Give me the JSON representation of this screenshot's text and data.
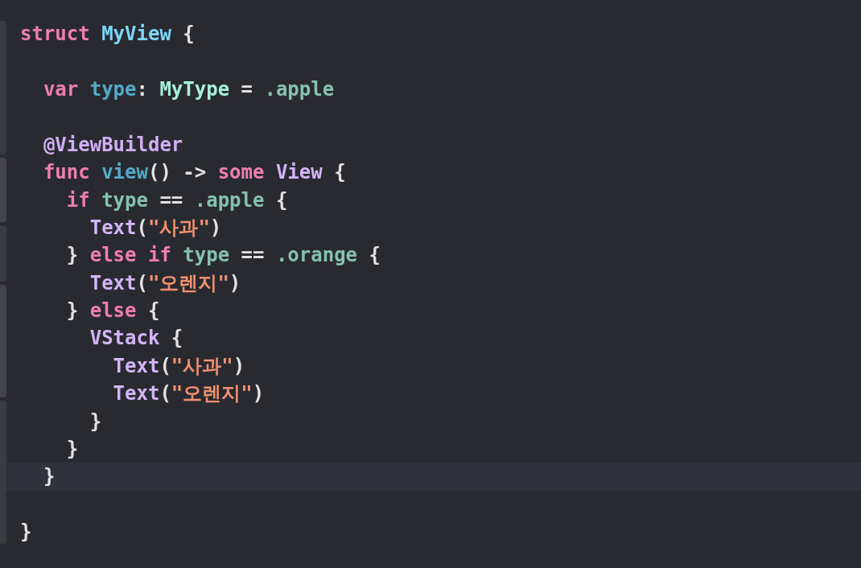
{
  "editor": {
    "lines": [
      {
        "kind": "line",
        "tokens": [
          {
            "text": "struct ",
            "kind": "keyword"
          },
          {
            "text": "MyView",
            "kind": "declaration"
          },
          {
            "text": " {",
            "kind": "plain"
          }
        ]
      },
      {
        "kind": "line"
      },
      {
        "kind": "line",
        "tokens": [
          {
            "text": "  var ",
            "kind": "keyword"
          },
          {
            "text": "type",
            "kind": "property"
          },
          {
            "text": ": ",
            "kind": "plain"
          },
          {
            "text": "MyType",
            "kind": "type"
          },
          {
            "text": " = ",
            "kind": "plain"
          },
          {
            "text": ".apple",
            "kind": "member"
          }
        ]
      },
      {
        "kind": "line"
      },
      {
        "kind": "line",
        "tokens": [
          {
            "text": "  @ViewBuilder",
            "kind": "attribute"
          }
        ]
      },
      {
        "kind": "line",
        "tokens": [
          {
            "text": "  func ",
            "kind": "keyword"
          },
          {
            "text": "view",
            "kind": "property"
          },
          {
            "text": "() -> ",
            "kind": "plain"
          },
          {
            "text": "some ",
            "kind": "keyword"
          },
          {
            "text": "View",
            "kind": "library"
          },
          {
            "text": " {",
            "kind": "plain"
          }
        ]
      },
      {
        "kind": "line",
        "tokens": [
          {
            "text": "    if ",
            "kind": "keyword"
          },
          {
            "text": "type",
            "kind": "member"
          },
          {
            "text": " == ",
            "kind": "plain"
          },
          {
            "text": ".apple",
            "kind": "member"
          },
          {
            "text": " {",
            "kind": "plain"
          }
        ]
      },
      {
        "kind": "line",
        "tokens": [
          {
            "text": "      Text",
            "kind": "library"
          },
          {
            "text": "(",
            "kind": "plain"
          },
          {
            "text": "\"사과\"",
            "kind": "string"
          },
          {
            "text": ")",
            "kind": "plain"
          }
        ]
      },
      {
        "kind": "line",
        "tokens": [
          {
            "text": "    } ",
            "kind": "plain"
          },
          {
            "text": "else if ",
            "kind": "keyword"
          },
          {
            "text": "type",
            "kind": "member"
          },
          {
            "text": " == ",
            "kind": "plain"
          },
          {
            "text": ".orange",
            "kind": "member"
          },
          {
            "text": " {",
            "kind": "plain"
          }
        ]
      },
      {
        "kind": "line",
        "tokens": [
          {
            "text": "      Text",
            "kind": "library"
          },
          {
            "text": "(",
            "kind": "plain"
          },
          {
            "text": "\"오렌지\"",
            "kind": "string"
          },
          {
            "text": ")",
            "kind": "plain"
          }
        ]
      },
      {
        "kind": "line",
        "tokens": [
          {
            "text": "    } ",
            "kind": "plain"
          },
          {
            "text": "else",
            "kind": "keyword"
          },
          {
            "text": " {",
            "kind": "plain"
          }
        ]
      },
      {
        "kind": "line",
        "tokens": [
          {
            "text": "      VStack",
            "kind": "library"
          },
          {
            "text": " {",
            "kind": "plain"
          }
        ]
      },
      {
        "kind": "line",
        "tokens": [
          {
            "text": "        Text",
            "kind": "library"
          },
          {
            "text": "(",
            "kind": "plain"
          },
          {
            "text": "\"사과\"",
            "kind": "string"
          },
          {
            "text": ")",
            "kind": "plain"
          }
        ]
      },
      {
        "kind": "line",
        "tokens": [
          {
            "text": "        Text",
            "kind": "library"
          },
          {
            "text": "(",
            "kind": "plain"
          },
          {
            "text": "\"오렌지\"",
            "kind": "string"
          },
          {
            "text": ")",
            "kind": "plain"
          }
        ]
      },
      {
        "kind": "line",
        "tokens": [
          {
            "text": "      }",
            "kind": "plain"
          }
        ]
      },
      {
        "kind": "line",
        "tokens": [
          {
            "text": "    }",
            "kind": "plain"
          }
        ]
      },
      {
        "kind": "current_line",
        "tokens": [
          {
            "text": "  }",
            "kind": "plain"
          }
        ]
      },
      {
        "kind": "line"
      },
      {
        "kind": "line",
        "tokens": [
          {
            "text": "}",
            "kind": "plain"
          }
        ]
      }
    ]
  }
}
